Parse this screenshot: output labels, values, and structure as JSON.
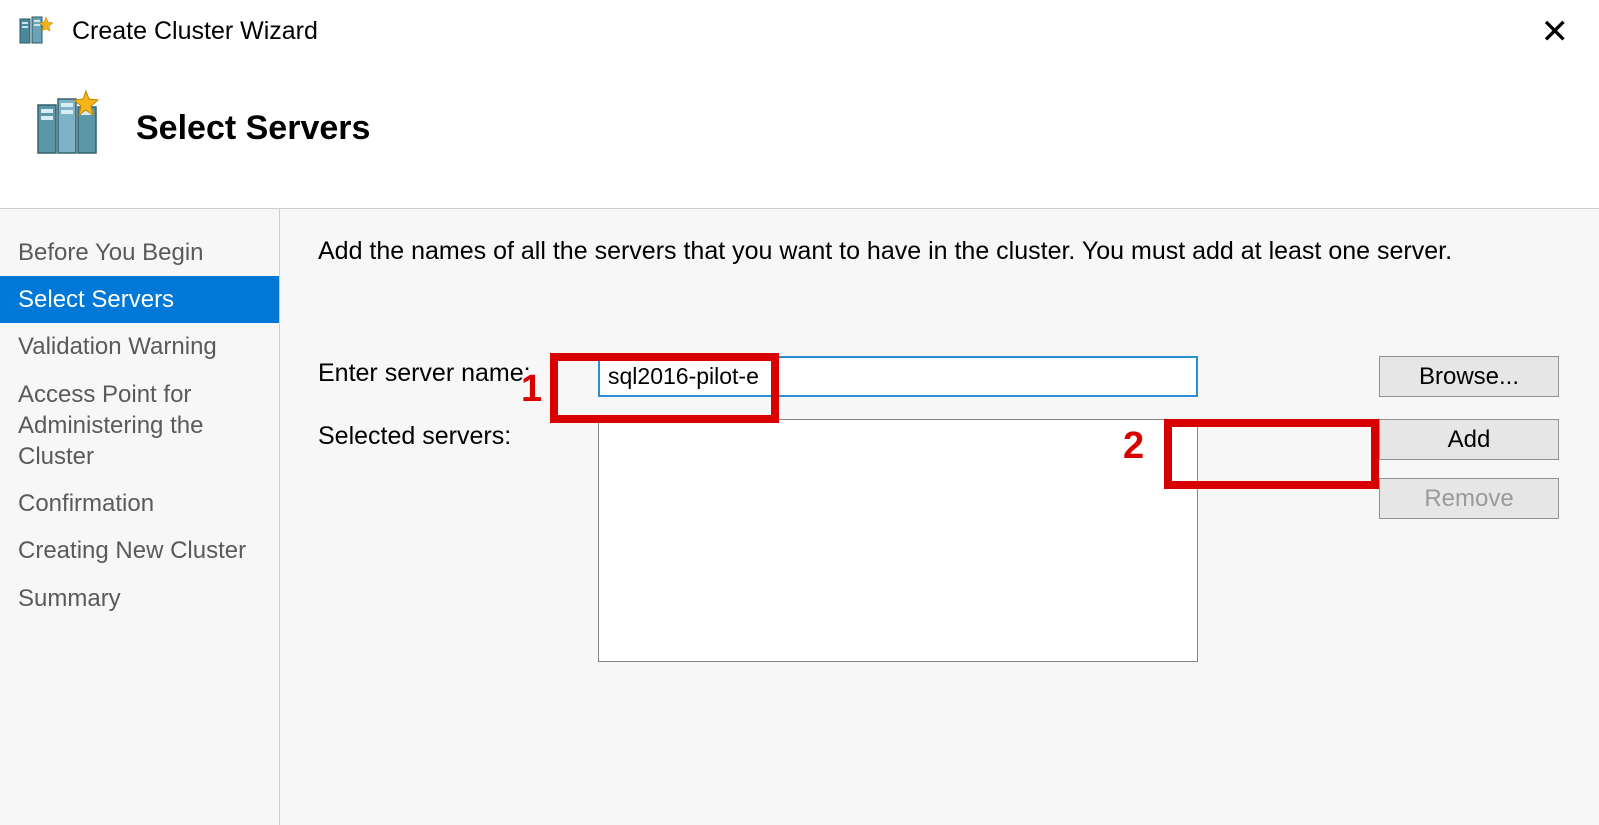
{
  "window": {
    "title": "Create Cluster Wizard"
  },
  "page": {
    "heading": "Select Servers",
    "instruction": "Add the names of all the servers that you want to have in the cluster. You must add at least one server."
  },
  "sidebar": {
    "items": [
      {
        "label": "Before You Begin",
        "active": false
      },
      {
        "label": "Select Servers",
        "active": true
      },
      {
        "label": "Validation Warning",
        "active": false
      },
      {
        "label": "Access Point for Administering the Cluster",
        "active": false
      },
      {
        "label": "Confirmation",
        "active": false
      },
      {
        "label": "Creating New Cluster",
        "active": false
      },
      {
        "label": "Summary",
        "active": false
      }
    ]
  },
  "form": {
    "server_name_label": "Enter server name:",
    "server_name_value": "sql2016-pilot-e",
    "selected_servers_label": "Selected servers:",
    "selected_servers": []
  },
  "buttons": {
    "browse": "Browse...",
    "add": "Add",
    "remove": "Remove"
  },
  "annotations": {
    "marker1": "1",
    "marker2": "2"
  }
}
